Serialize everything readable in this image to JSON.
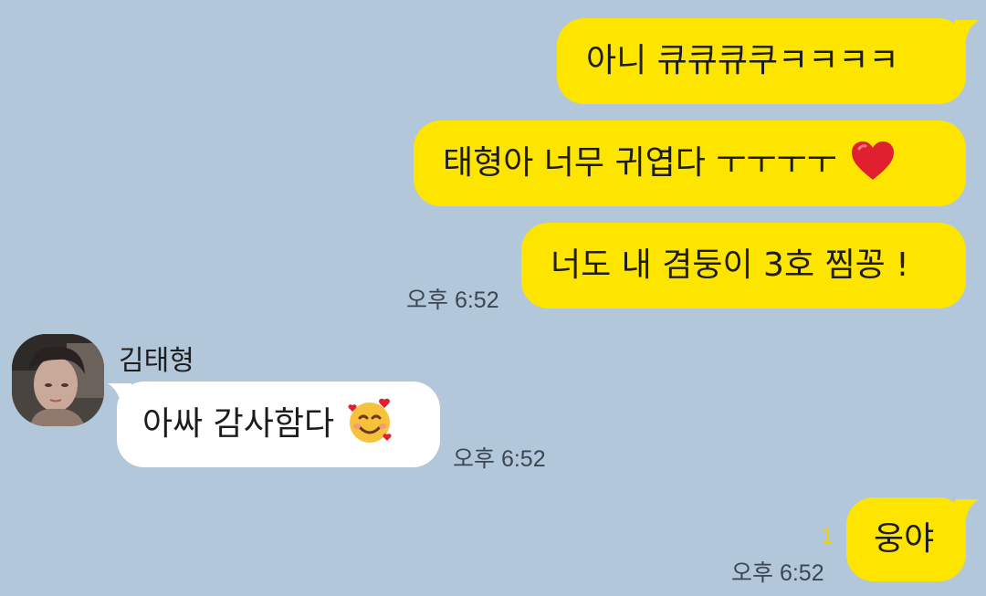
{
  "messages": {
    "m1": {
      "text": "아니 큐큐큐쿠ㅋㅋㅋㅋ"
    },
    "m2": {
      "text": "태형아 너무 귀엽다 ㅜㅜㅜㅜ",
      "emoji": "red-heart-icon"
    },
    "m3": {
      "text": "너도 내 겸둥이 3호 찜꽁 !",
      "time": "오후 6:52"
    },
    "m4": {
      "sender": "김태형",
      "text": "아싸 감사함다",
      "emoji": "smiling-face-with-hearts-icon",
      "time": "오후 6:52"
    },
    "m5": {
      "text": "웅야",
      "unread": "1",
      "time": "오후 6:52"
    }
  },
  "colors": {
    "background": "#b2c7d9",
    "outgoing_bubble": "#fee500",
    "incoming_bubble": "#ffffff",
    "unread": "#f2d000"
  }
}
